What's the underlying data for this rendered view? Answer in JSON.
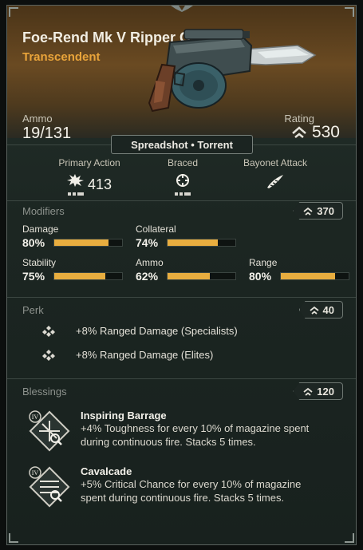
{
  "weapon": {
    "name": "Foe-Rend Mk V Ripper Gun",
    "rarity": "Transcendent",
    "ammo_label": "Ammo",
    "ammo_value": "19/131",
    "rating_label": "Rating",
    "rating_value": "530",
    "fire_mode": "Spreadshot • Torrent"
  },
  "actions": [
    {
      "label": "Primary Action",
      "value": "413",
      "icon": "explosive-burst-icon"
    },
    {
      "label": "Braced",
      "value": "",
      "icon": "crosshair-target-icon"
    },
    {
      "label": "Bayonet Attack",
      "value": "",
      "icon": "blade-slash-icon"
    }
  ],
  "modifiers": {
    "title": "Modifiers",
    "rating": "370",
    "stats": [
      {
        "label": "Damage",
        "value": "80%",
        "level": 0.8
      },
      {
        "label": "Collateral",
        "value": "74%",
        "level": 0.74
      },
      {
        "label": "Stability",
        "value": "75%",
        "level": 0.75
      },
      {
        "label": "Ammo",
        "value": "62%",
        "level": 0.62
      },
      {
        "label": "Range",
        "value": "80%",
        "level": 0.8
      }
    ]
  },
  "perk": {
    "title": "Perk",
    "rating": "40",
    "items": [
      "+8% Ranged Damage (Specialists)",
      "+8% Ranged Damage (Elites)"
    ]
  },
  "blessings": {
    "title": "Blessings",
    "rating": "120",
    "items": [
      {
        "tier": "IV",
        "name": "Inspiring Barrage",
        "desc_line1": "+4% Toughness for every 10% of magazine spent",
        "desc_line2": "during continuous fire. Stacks 5 times."
      },
      {
        "tier": "IV",
        "name": "Cavalcade",
        "desc_line1": "+5% Critical Chance for every 10% of magazine",
        "desc_line2": "spent during continuous fire. Stacks 5 times."
      }
    ]
  },
  "colors": {
    "accent_gold": "#e8ad3f",
    "rarity_orange": "#e9a43a",
    "panel_green": "#1c2622"
  }
}
